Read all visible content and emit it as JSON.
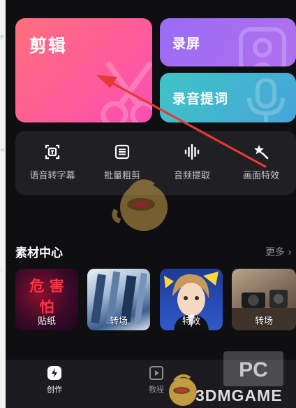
{
  "cards": {
    "edit": "剪辑",
    "record": "录屏",
    "teleprompt": "录音提词"
  },
  "tools": [
    {
      "label": "语音转字幕",
      "icon": "subtitle-icon"
    },
    {
      "label": "批量粗剪",
      "icon": "list-icon"
    },
    {
      "label": "音频提取",
      "icon": "waveform-icon"
    },
    {
      "label": "画面特效",
      "icon": "magic-wand-icon"
    }
  ],
  "materials": {
    "title": "素材中心",
    "more": "更多",
    "items": [
      {
        "label": "贴纸",
        "art": "危 害怕"
      },
      {
        "label": "转场"
      },
      {
        "label": "特效"
      },
      {
        "label": "转场"
      }
    ]
  },
  "tabbar": {
    "create": "创作",
    "tutorial": "教程"
  },
  "watermark": {
    "brand": "3DMGAME"
  },
  "colors": {
    "edit_card": "#ff5c98",
    "record_card": "#a06ef2",
    "teleprompt_card": "#42b6cf",
    "annotation_arrow": "#e53935"
  }
}
